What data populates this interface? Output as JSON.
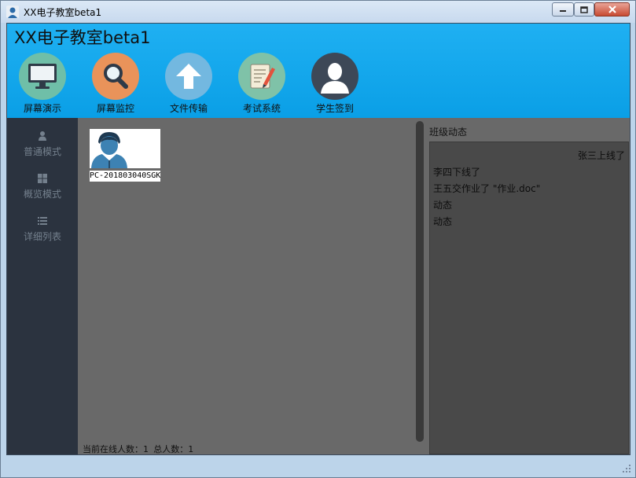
{
  "window": {
    "title": "XX电子教室beta1"
  },
  "app": {
    "title": "XX电子教室beta1"
  },
  "toolbar": [
    {
      "label": "屏幕演示",
      "icon": "monitor-icon",
      "color": "#6fbfa8"
    },
    {
      "label": "屏幕监控",
      "icon": "magnifier-icon",
      "color": "#e9935a"
    },
    {
      "label": "文件传输",
      "icon": "upload-arrow-icon",
      "color": "#73b8e0"
    },
    {
      "label": "考试系统",
      "icon": "exam-pencil-icon",
      "color": "#7fc2a8"
    },
    {
      "label": "学生签到",
      "icon": "user-silhouette-icon",
      "color": "#3d4857"
    }
  ],
  "sidebar": {
    "items": [
      {
        "label": "普通模式",
        "icon": "person-icon"
      },
      {
        "label": "概览模式",
        "icon": "grid-icon"
      },
      {
        "label": "详细列表",
        "icon": "list-icon"
      }
    ]
  },
  "students": [
    {
      "name": "PC-201803040SGK",
      "icon": "student-avatar-icon"
    }
  ],
  "status": {
    "online_text": "当前在线人数：1 总人数：1"
  },
  "feed": {
    "title": "班级动态",
    "items": [
      {
        "text": "张三上线了",
        "align": "right"
      },
      {
        "text": "李四下线了",
        "align": "left"
      },
      {
        "text": "王五交作业了 \"作业.doc\"",
        "align": "left"
      },
      {
        "text": "动态",
        "align": "left"
      },
      {
        "text": "动态",
        "align": "left"
      }
    ]
  },
  "colors": {
    "header": "#0aa3ea",
    "sidebar": "#2b333f",
    "main": "#696969",
    "feed": "#494949"
  }
}
